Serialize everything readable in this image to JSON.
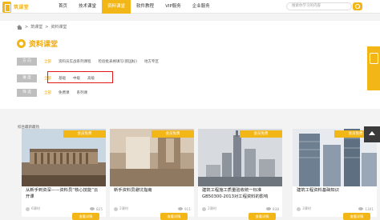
{
  "logo": {
    "text": "筑课堂",
    "icon": "logo-icon"
  },
  "nav": {
    "items": [
      {
        "label": "首页"
      },
      {
        "label": "技术课堂"
      },
      {
        "label": "资料课堂",
        "active": true
      },
      {
        "label": "软件教程"
      },
      {
        "label": "VIP服务"
      },
      {
        "label": "企业服务"
      }
    ]
  },
  "search": {
    "placeholder": "搜索你学习的内容"
  },
  "breadcrumb": {
    "items": [
      "筑课堂",
      "资料课堂"
    ],
    "separator": ">"
  },
  "page": {
    "title": "资料课堂"
  },
  "filters": [
    {
      "label": "方 向",
      "options": [
        "全部",
        "资料员实战系列课程",
        "检验批表格填写(新国标)",
        "地方专区"
      ],
      "active": 0
    },
    {
      "label": "难 度",
      "options": [
        "全部",
        "基础",
        "中级",
        "高级"
      ],
      "active": 0
    },
    {
      "label": "筛 选",
      "options": [
        "全部",
        "免费课",
        "系列课"
      ],
      "active": 0
    }
  ],
  "courses": {
    "section_title": "综合最新最热",
    "items": [
      {
        "badge": "会员免费",
        "title": "从新手到资深——资料员“核心技能”云开课",
        "lessons": "6课时",
        "views": "825",
        "button": "查看详情"
      },
      {
        "badge": "会员免费",
        "title": "新手资料员避坑指南",
        "lessons": "2课时",
        "views": "911",
        "button": "查看详情"
      },
      {
        "badge": "会员免费",
        "title": "建筑工程施工质量验收统一标准GB50300-2013对工程资料的影响",
        "lessons": "2课时",
        "views": "838",
        "button": "查看详情"
      },
      {
        "badge": "会员免费",
        "title": "建筑工程资料基础知识",
        "lessons": "3课时",
        "views": "1301",
        "button": "查看详情"
      }
    ]
  },
  "colors": {
    "accent": "#f3b617",
    "highlight_box": "#e01818"
  }
}
